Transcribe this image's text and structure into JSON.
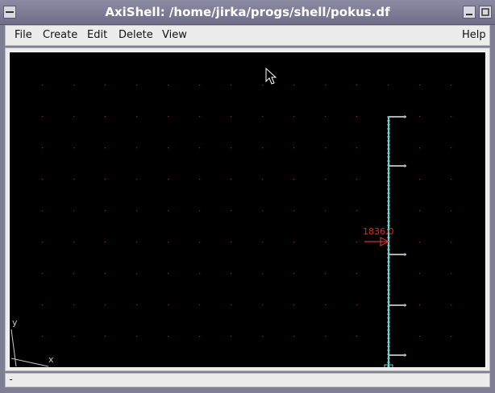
{
  "window": {
    "title": "AxiShell: /home/jirka/progs/shell/pokus.df",
    "controls": [
      "_",
      "□",
      "✕"
    ]
  },
  "menu": {
    "file": "File",
    "create": "Create",
    "edit": "Edit",
    "delete": "Delete",
    "view": "View",
    "help": "Help"
  },
  "canvas": {
    "background": "#000000",
    "grid_color": "#8b2a2a",
    "shell_color": "#5fd7d7",
    "stub_color": "#b0b0b0",
    "load_color": "#d03030",
    "load_label": "1836.0",
    "axis_x_label": "x",
    "axis_y_label": "y"
  },
  "status": {
    "text": "-"
  }
}
